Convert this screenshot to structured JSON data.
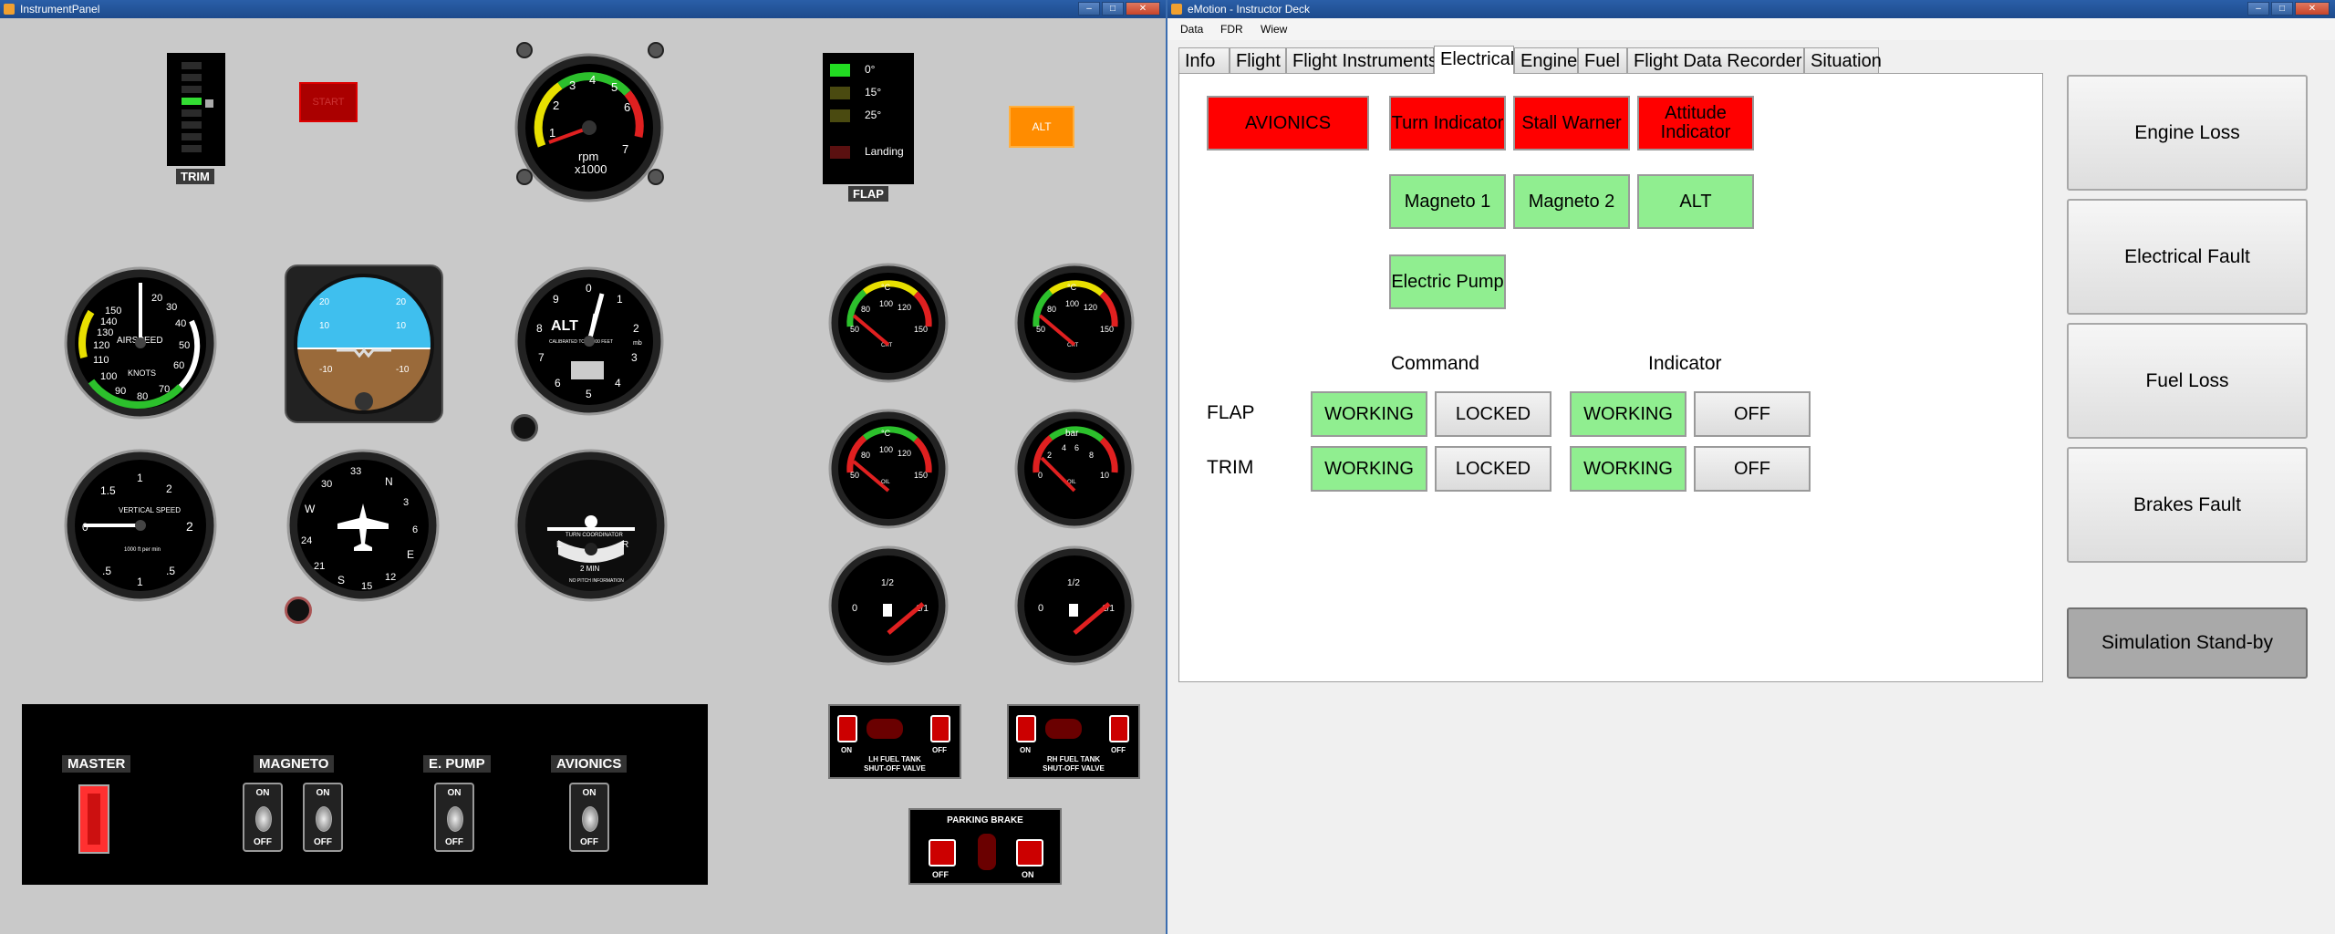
{
  "left_window": {
    "title": "InstrumentPanel"
  },
  "right_window": {
    "title": "eMotion - Instructor Deck"
  },
  "window_buttons": {
    "min": "–",
    "max": "□",
    "close": "✕"
  },
  "panel": {
    "trim_label": "TRIM",
    "start_label": "START",
    "alt_label": "ALT",
    "flap_label": "FLAP",
    "flap_positions": [
      "0°",
      "15°",
      "25°",
      "Landing"
    ],
    "rpm": {
      "unit": "rpm",
      "sub": "x1000",
      "ticks": [
        "1",
        "2",
        "3",
        "4",
        "5",
        "6",
        "7"
      ]
    },
    "airspeed": {
      "title": "AIRSPEED",
      "unit": "KNOTS",
      "ticks": [
        "150",
        "140",
        "130",
        "120",
        "110",
        "100",
        "90",
        "80",
        "70",
        "60",
        "50",
        "40",
        "30",
        "20"
      ]
    },
    "attitude": {
      "ticks": [
        "20",
        "10",
        "-10"
      ]
    },
    "altimeter": {
      "title": "ALT",
      "ticks": [
        "0",
        "1",
        "2",
        "3",
        "4",
        "5",
        "6",
        "7",
        "8",
        "9"
      ],
      "sub": "CALIBRATED TO 20,000 FEET",
      "unit": "mb"
    },
    "vsi": {
      "title": "VERTICAL SPEED",
      "sub": "1000 ft per min",
      "ticks": [
        "1",
        "5",
        "2",
        ".5",
        "1.5",
        "0",
        ".5",
        "1",
        "1.5",
        "2"
      ]
    },
    "heading": {
      "ticks": [
        "N",
        "3",
        "6",
        "E",
        "12",
        "15",
        "S",
        "21",
        "24",
        "W",
        "30",
        "33"
      ]
    },
    "turn": {
      "title": "TURN COORDINATOR",
      "l": "L",
      "r": "R",
      "sub": "2 MIN",
      "foot": "NO PITCH INFORMATION"
    },
    "cht_gauges": [
      {
        "unit": "°C",
        "ticks": [
          "50",
          "80",
          "100",
          "120",
          "150"
        ],
        "label": "CHT"
      },
      {
        "unit": "°C",
        "ticks": [
          "50",
          "80",
          "100",
          "120",
          "150"
        ],
        "label": "CHT"
      },
      {
        "unit": "°C",
        "ticks": [
          "50",
          "80",
          "100",
          "120",
          "150"
        ],
        "label": "OIL"
      }
    ],
    "press_gauge": {
      "unit": "bar",
      "ticks": [
        "0",
        "2",
        "4",
        "6",
        "8",
        "10"
      ],
      "label": "OIL"
    },
    "fuel_gauges": [
      {
        "ticks": [
          "0",
          "1/2",
          "1/1"
        ]
      },
      {
        "ticks": [
          "0",
          "1/2",
          "1/1"
        ]
      }
    ],
    "switches": {
      "master": "MASTER",
      "magneto": "MAGNETO",
      "epump": "E. PUMP",
      "avionics": "AVIONICS",
      "on": "ON",
      "off": "OFF"
    },
    "lh_valve": {
      "line1": "LH FUEL TANK",
      "line2": "SHUT-OFF VALVE",
      "on": "ON",
      "off": "OFF"
    },
    "rh_valve": {
      "line1": "RH FUEL TANK",
      "line2": "SHUT-OFF VALVE",
      "on": "ON",
      "off": "OFF"
    },
    "parking_brake": {
      "title": "PARKING BRAKE",
      "off": "OFF",
      "on": "ON"
    }
  },
  "menu": [
    "Data",
    "FDR",
    "Wiew"
  ],
  "tabs": [
    "Info",
    "Flight",
    "Flight Instruments",
    "Electrical",
    "Engine",
    "Fuel",
    "Flight Data Recorder",
    "Situation"
  ],
  "active_tab": "Electrical",
  "electrical": {
    "avionics": "AVIONICS",
    "turn_indicator": "Turn Indicator",
    "stall_warner": "Stall Warner",
    "attitude_indicator": "Attitude Indicator",
    "magneto1": "Magneto 1",
    "magneto2": "Magneto 2",
    "alt": "ALT",
    "electric_pump": "Electric Pump",
    "command": "Command",
    "indicator": "Indicator",
    "flap": "FLAP",
    "trim": "TRIM",
    "working": "WORKING",
    "locked": "LOCKED",
    "off": "OFF"
  },
  "side_buttons": [
    "Engine Loss",
    "Electrical Fault",
    "Fuel Loss",
    "Brakes Fault"
  ],
  "standby_button": "Simulation Stand-by",
  "colors": {
    "red": "#ff0000",
    "green": "#90ee90",
    "title_blue": "#2a5fa8",
    "alt_orange": "#ff8c00"
  }
}
